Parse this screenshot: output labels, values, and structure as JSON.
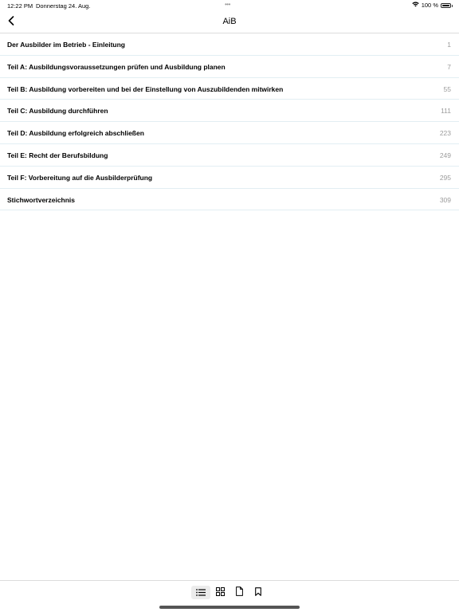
{
  "status_bar": {
    "time": "12:22 PM",
    "date": "Donnerstag 24. Aug.",
    "dots": "•••",
    "battery_text": "100 %",
    "wifi_icon": "wifi-icon",
    "battery_icon": "battery-full-icon"
  },
  "nav": {
    "title": "AiB",
    "back_icon": "chevron-left-icon"
  },
  "toc": [
    {
      "title": "Der Ausbilder im Betrieb - Einleitung",
      "page": "1"
    },
    {
      "title": "Teil A: Ausbildungsvoraussetzungen prüfen und Ausbildung planen",
      "page": "7"
    },
    {
      "title": "Teil B: Ausbildung vorbereiten und bei der Einstellung von Auszubildenden mitwirken",
      "page": "55"
    },
    {
      "title": "Teil C: Ausbildung durchführen",
      "page": "111"
    },
    {
      "title": "Teil D: Ausbildung erfolgreich abschließen",
      "page": "223"
    },
    {
      "title": "Teil E: Recht der Berufsbildung",
      "page": "249"
    },
    {
      "title": "Teil F: Vorbereitung auf die Ausbilderprüfung",
      "page": "295"
    },
    {
      "title": "Stichwortverzeichnis",
      "page": "309"
    }
  ],
  "tabs": [
    {
      "icon": "list-icon",
      "active": true
    },
    {
      "icon": "grid-icon",
      "active": false
    },
    {
      "icon": "document-icon",
      "active": false
    },
    {
      "icon": "bookmark-icon",
      "active": false
    }
  ],
  "colors": {
    "divider": "#e2eef3",
    "page_number": "#9b9b9b",
    "active_tab_bg": "#ececec"
  }
}
